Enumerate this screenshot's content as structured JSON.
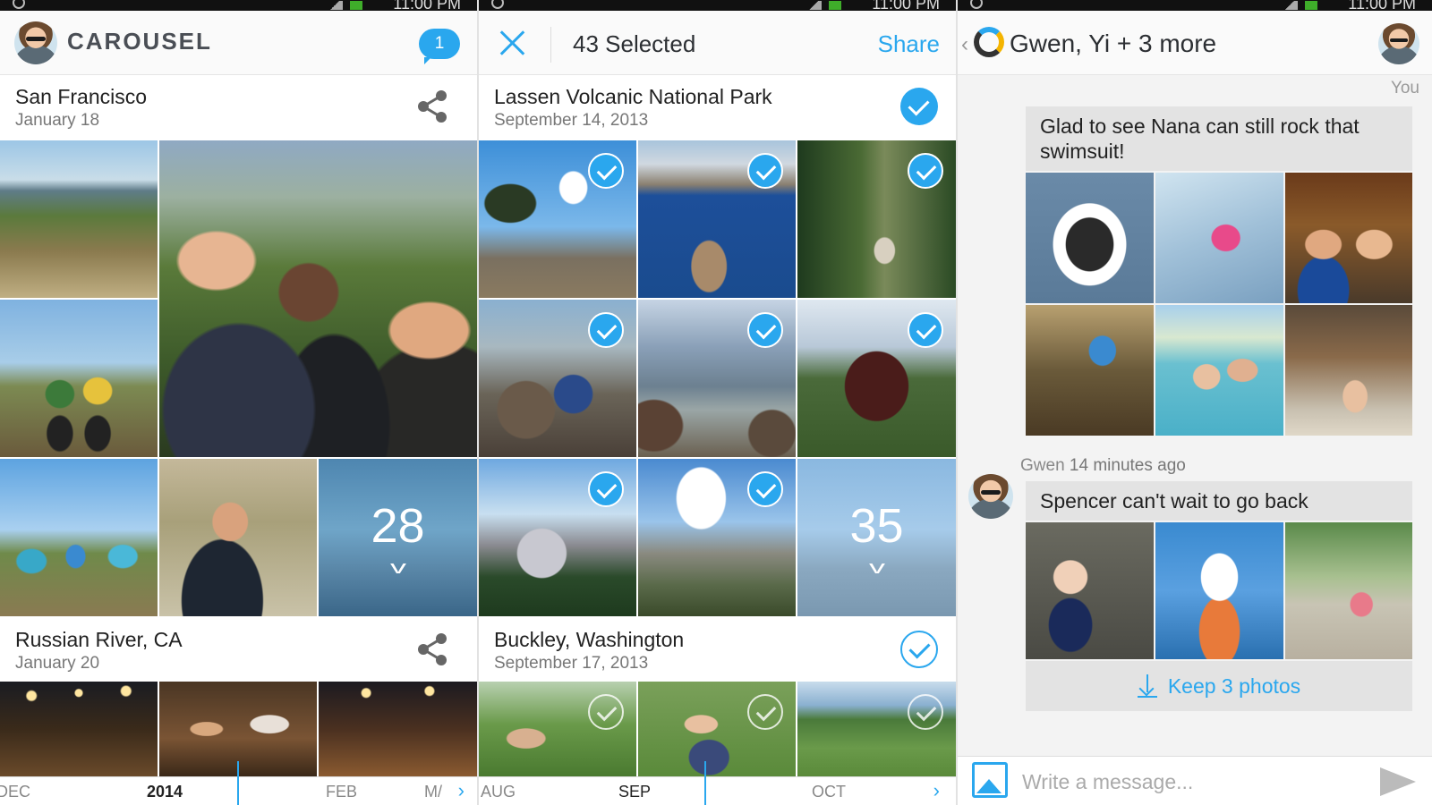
{
  "colors": {
    "accent": "#2aa7ee",
    "text": "#222222",
    "muted": "#777777",
    "bubble": "#e3e3e3"
  },
  "status_bar": {
    "time": "11:00 PM"
  },
  "feed": {
    "brand": "CAROUSEL",
    "notification_count": "1",
    "sections": [
      {
        "title": "San Francisco",
        "date": "January 18",
        "more_count": "28"
      },
      {
        "title": "Russian River, CA",
        "date": "January 20"
      }
    ],
    "timeline": {
      "labels": [
        "DEC",
        "2014",
        "FEB",
        "M/"
      ],
      "active": "2014"
    }
  },
  "selection": {
    "count_label": "43 Selected",
    "share_label": "Share",
    "sections": [
      {
        "title": "Lassen Volcanic National Park",
        "date": "September 14, 2013",
        "more_count": "35"
      },
      {
        "title": "Buckley, Washington",
        "date": "September 17, 2013"
      }
    ],
    "timeline": {
      "labels": [
        "AUG",
        "SEP",
        "OCT"
      ],
      "active": "SEP"
    }
  },
  "conversation": {
    "title": "Gwen, Yi + 3 more",
    "you_label": "You",
    "messages": [
      {
        "text": "Glad to see Nana can still rock that swimsuit!"
      },
      {
        "author": "Gwen",
        "time": "14 minutes ago",
        "text": "Spencer can't wait to go back"
      }
    ],
    "keep_button": "Keep 3 photos",
    "composer_placeholder": "Write a message..."
  }
}
